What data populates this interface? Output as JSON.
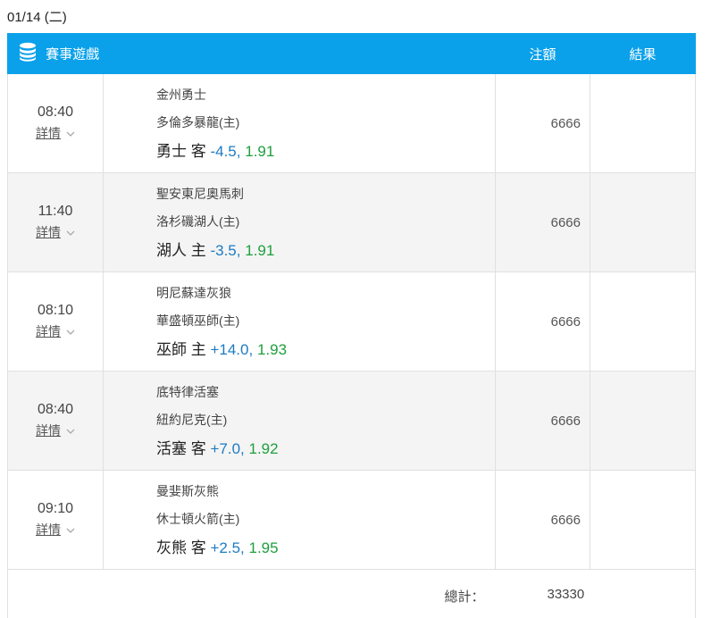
{
  "date_title": "01/14 (二)",
  "header": {
    "game_label": "賽事遊戲",
    "bet_label": "注額",
    "result_label": "結果"
  },
  "rows": [
    {
      "time": "08:40",
      "detail": "詳情",
      "team1": "金州勇士",
      "team2": "多倫多暴龍(主)",
      "bet_team": "勇士 客",
      "handicap": "-4.5,",
      "odds": "1.91",
      "amount": "6666",
      "result": ""
    },
    {
      "time": "11:40",
      "detail": "詳情",
      "team1": "聖安東尼奧馬刺",
      "team2": "洛杉磯湖人(主)",
      "bet_team": "湖人 主",
      "handicap": "-3.5,",
      "odds": "1.91",
      "amount": "6666",
      "result": ""
    },
    {
      "time": "08:10",
      "detail": "詳情",
      "team1": "明尼蘇達灰狼",
      "team2": "華盛頓巫師(主)",
      "bet_team": "巫師 主",
      "handicap": "+14.0,",
      "odds": "1.93",
      "amount": "6666",
      "result": ""
    },
    {
      "time": "08:40",
      "detail": "詳情",
      "team1": "底特律活塞",
      "team2": "紐約尼克(主)",
      "bet_team": "活塞 客",
      "handicap": "+7.0,",
      "odds": "1.92",
      "amount": "6666",
      "result": ""
    },
    {
      "time": "09:10",
      "detail": "詳情",
      "team1": "曼婓斯灰熊",
      "team2": "休士頓火箭(主)",
      "bet_team": "灰熊 客",
      "handicap": "+2.5,",
      "odds": "1.95",
      "amount": "6666",
      "result": ""
    }
  ],
  "total": {
    "label": "總計：",
    "value": "33330"
  },
  "colors": {
    "header_bg": "#0aa1ea",
    "handicap": "#1e7bc2",
    "odds": "#1e9f3c",
    "alt_row": "#f4f4f4"
  },
  "icons": {
    "header": "database-icon",
    "detail": "chevron-down-icon"
  }
}
